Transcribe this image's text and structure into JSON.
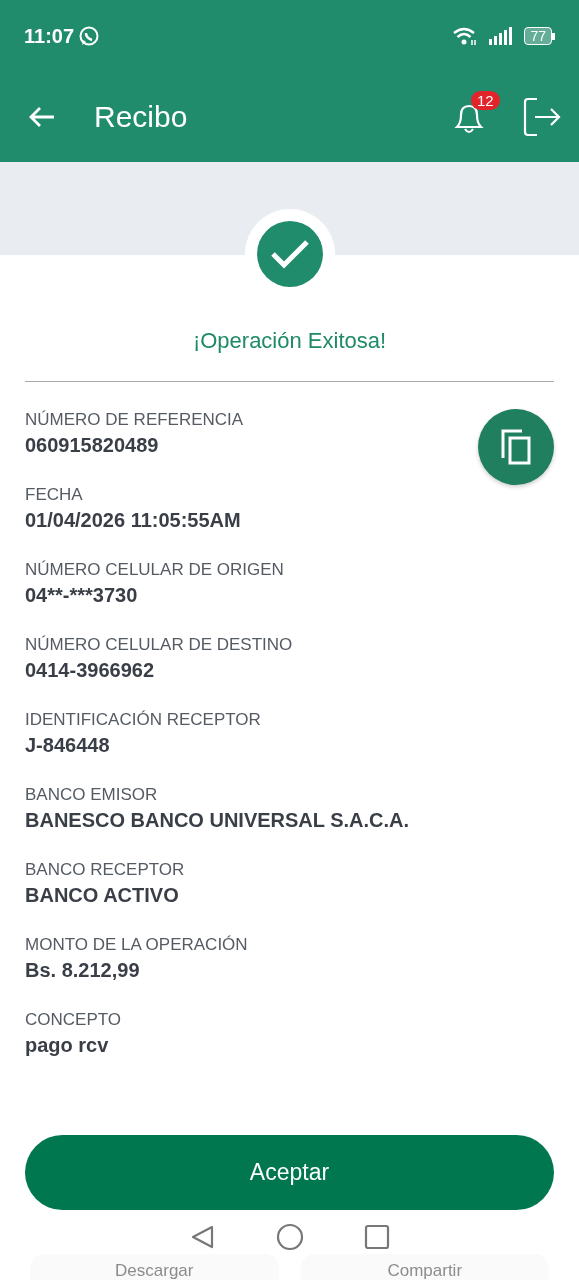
{
  "status_bar": {
    "time": "11:07",
    "battery": "77"
  },
  "app_bar": {
    "title": "Recibo",
    "notification_count": "12"
  },
  "result": {
    "title": "¡Operación Exitosa!"
  },
  "fields": [
    {
      "label": "NÚMERO DE REFERENCIA",
      "value": "060915820489"
    },
    {
      "label": "FECHA",
      "value": "01/04/2026 11:05:55AM"
    },
    {
      "label": "NÚMERO CELULAR DE ORIGEN",
      "value": "04**-***3730"
    },
    {
      "label": "NÚMERO CELULAR DE DESTINO",
      "value": "0414-3966962"
    },
    {
      "label": "IDENTIFICACIÓN RECEPTOR",
      "value": "J-846448"
    },
    {
      "label": "BANCO EMISOR",
      "value": "BANESCO BANCO UNIVERSAL S.A.C.A."
    },
    {
      "label": "BANCO RECEPTOR",
      "value": "BANCO ACTIVO"
    },
    {
      "label": "MONTO DE LA OPERACIÓN",
      "value": "Bs. 8.212,99"
    },
    {
      "label": "CONCEPTO",
      "value": "pago rcv"
    }
  ],
  "primary_button": "Aceptar",
  "secondary_buttons": [
    "Descargar",
    "Compartir"
  ]
}
